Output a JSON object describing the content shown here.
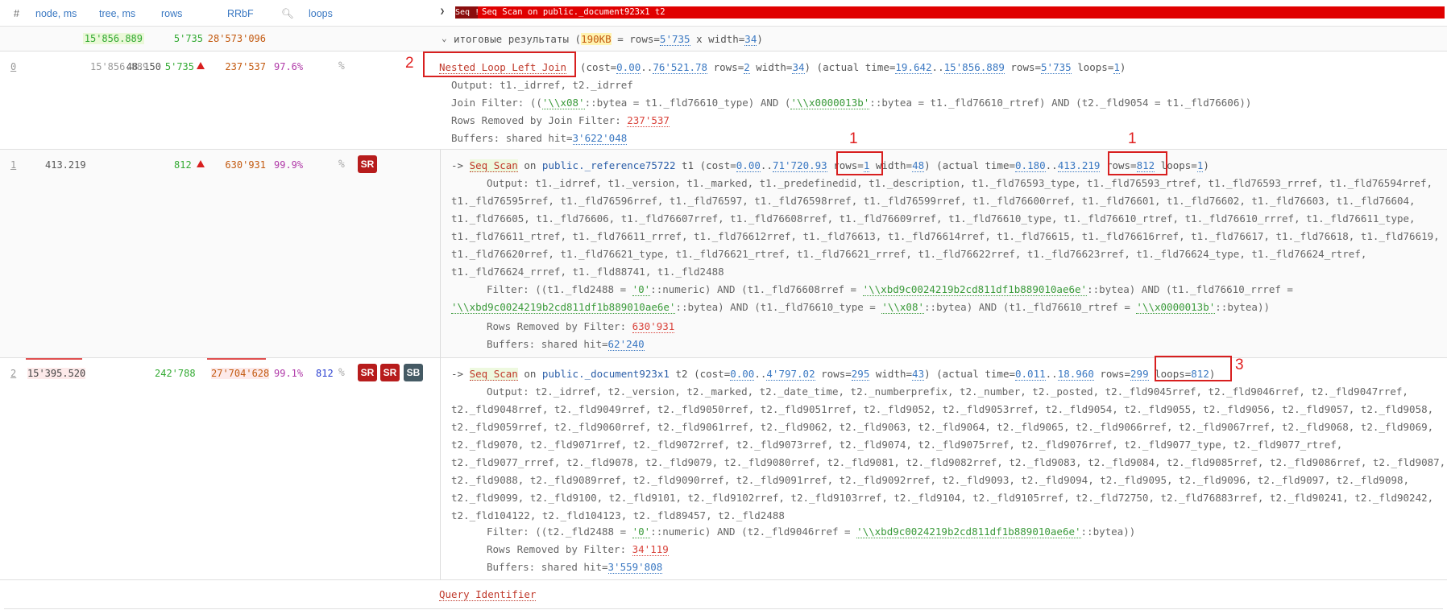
{
  "header": {
    "hash": "#",
    "node_ms": "node, ms",
    "tree_ms": "tree, ms",
    "rows": "rows",
    "rrbf": "RRbF",
    "loops": "loops",
    "tab_short": "Seq !",
    "tab_title": "Seq Scan on public._document923x1 t2"
  },
  "totals": {
    "tree_ms": "15'856.889",
    "rows": "5'735",
    "rrbf": "28'573'096",
    "label": "итоговые результаты",
    "size": "190KB",
    "expr_eq": " = rows=",
    "rows_val": "5'735",
    "x_width": " x width=",
    "width_val": "34",
    "close": ")"
  },
  "nodes": [
    {
      "idx": "0",
      "node_ms": "48.150",
      "tree_ms": "15'856.889",
      "rows": "5'735",
      "rrbf": "237'537",
      "pct": "97.6%",
      "title": "Nested Loop Left Join",
      "cost_a": "0.00",
      "cost_b": "76'521.78",
      "rows_est": "2",
      "width": "34",
      "time_a": "19.642",
      "time_b": "15'856.889",
      "rows_act": "5'735",
      "loops": "1",
      "output": "Output: t1._idrref, t2._idrref",
      "join_filter_pre": "Join Filter: ((",
      "jf_s1": "'\\\\x08'",
      "jf_m1": "::bytea = t1._fld76610_type) AND (",
      "jf_s2": "'\\\\x0000013b'",
      "jf_m2": "::bytea = t1._fld76610_rtref) AND (t2._fld9054 = t1._fld76606))",
      "removed_label": "Rows Removed by Join Filter: ",
      "removed": "237'537",
      "buffers_label": "Buffers: shared hit=",
      "buffers": "3'622'048"
    },
    {
      "idx": "1",
      "node_ms": "413.219",
      "rows": "812",
      "rrbf": "630'931",
      "pct": "99.9%",
      "badge": "SR",
      "scan": "Seq Scan",
      "on": " on ",
      "rel": "public._reference75722",
      "alias": " t1",
      "cost_a": "0.00",
      "cost_b": "71'720.93",
      "rows_est": "1",
      "width": "48",
      "time_a": "0.180",
      "time_b": "413.219",
      "rows_act": "812",
      "loops": "1",
      "output_lines": [
        "Output: t1._idrref, t1._version, t1._marked, t1._predefinedid, t1._description, t1._fld76593_type, t1._fld76593_rtref, t1._fld76593_rrref, t1._fld76594rref,",
        "t1._fld76595rref, t1._fld76596rref, t1._fld76597, t1._fld76598rref, t1._fld76599rref, t1._fld76600rref, t1._fld76601, t1._fld76602, t1._fld76603, t1._fld76604,",
        "t1._fld76605, t1._fld76606, t1._fld76607rref, t1._fld76608rref, t1._fld76609rref, t1._fld76610_type, t1._fld76610_rtref, t1._fld76610_rrref, t1._fld76611_type,",
        "t1._fld76611_rtref, t1._fld76611_rrref, t1._fld76612rref, t1._fld76613, t1._fld76614rref, t1._fld76615, t1._fld76616rref, t1._fld76617, t1._fld76618, t1._fld76619,",
        "t1._fld76620rref, t1._fld76621_type, t1._fld76621_rtref, t1._fld76621_rrref, t1._fld76622rref, t1._fld76623rref, t1._fld76624_type, t1._fld76624_rtref,",
        "t1._fld76624_rrref, t1._fld88741, t1._fld2488"
      ],
      "filter_pre": "Filter: ((t1._fld2488 = ",
      "f_s0": "'0'",
      "f_m0": "::numeric) AND (t1._fld76608rref = ",
      "f_s1": "'\\\\xbd9c0024219b2cd811df1b889010ae6e'",
      "f_m1": "::bytea) AND (t1._fld76610_rrref =",
      "f_s2": "'\\\\xbd9c0024219b2cd811df1b889010ae6e'",
      "f_m2": "::bytea) AND (t1._fld76610_type = ",
      "f_s3": "'\\\\x08'",
      "f_m3": "::bytea) AND (t1._fld76610_rtref = ",
      "f_s4": "'\\\\x0000013b'",
      "f_m4": "::bytea))",
      "removed_label": "Rows Removed by Filter: ",
      "removed": "630'931",
      "buffers_label": "Buffers: shared hit=",
      "buffers": "62'240"
    },
    {
      "idx": "2",
      "node_ms": "15'395.520",
      "rows": "242'788",
      "rrbf": "27'704'628",
      "pct": "99.1%",
      "loops_col": "812",
      "badges": [
        "SR",
        "SR",
        "SB"
      ],
      "scan": "Seq Scan",
      "on": " on ",
      "rel": "public._document923x1",
      "alias": " t2",
      "cost_a": "0.00",
      "cost_b": "4'797.02",
      "rows_est": "295",
      "width": "43",
      "time_a": "0.011",
      "time_b": "18.960",
      "rows_act": "299",
      "loops": "812",
      "output_lines": [
        "Output: t2._idrref, t2._version, t2._marked, t2._date_time, t2._numberprefix, t2._number, t2._posted, t2._fld9045rref, t2._fld9046rref, t2._fld9047rref,",
        "t2._fld9048rref, t2._fld9049rref, t2._fld9050rref, t2._fld9051rref, t2._fld9052, t2._fld9053rref, t2._fld9054, t2._fld9055, t2._fld9056, t2._fld9057, t2._fld9058,",
        "t2._fld9059rref, t2._fld9060rref, t2._fld9061rref, t2._fld9062, t2._fld9063, t2._fld9064, t2._fld9065, t2._fld9066rref, t2._fld9067rref, t2._fld9068, t2._fld9069,",
        "t2._fld9070, t2._fld9071rref, t2._fld9072rref, t2._fld9073rref, t2._fld9074, t2._fld9075rref, t2._fld9076rref, t2._fld9077_type, t2._fld9077_rtref,",
        "t2._fld9077_rrref, t2._fld9078, t2._fld9079, t2._fld9080rref, t2._fld9081, t2._fld9082rref, t2._fld9083, t2._fld9084, t2._fld9085rref, t2._fld9086rref, t2._fld9087,",
        "t2._fld9088, t2._fld9089rref, t2._fld9090rref, t2._fld9091rref, t2._fld9092rref, t2._fld9093, t2._fld9094, t2._fld9095, t2._fld9096, t2._fld9097, t2._fld9098,",
        "t2._fld9099, t2._fld9100, t2._fld9101, t2._fld9102rref, t2._fld9103rref, t2._fld9104, t2._fld9105rref, t2._fld72750, t2._fld76883rref, t2._fld90241, t2._fld90242,",
        "t2._fld104122, t2._fld104123, t2._fld89457, t2._fld2488"
      ],
      "filter_pre": "Filter: ((t2._fld2488 = ",
      "f_s0": "'0'",
      "f_m0": "::numeric) AND (t2._fld9046rref = ",
      "f_s1": "'\\\\xbd9c0024219b2cd811df1b889010ae6e'",
      "f_m1": "::bytea))",
      "removed_label": "Rows Removed by Filter: ",
      "removed": "34'119",
      "buffers_label": "Buffers: shared hit=",
      "buffers": "3'559'808"
    }
  ],
  "footer": {
    "query_id": "Query Identifier"
  },
  "syntax": {
    "arrow": "->",
    "cost_open": "(cost=",
    "range": "..",
    "rows_eq": " rows=",
    "width_eq": " width=",
    "actual_open": ") (actual time=",
    "loops_eq": " loops=",
    "close": ")",
    "rows_kw": "rows=",
    "loops_kw": "loops="
  },
  "annotations": {
    "one": "1",
    "two": "2",
    "three": "3"
  },
  "colors": {
    "accent": "#3a78c2",
    "tab_red": "#e00000",
    "badge_sr": "#b71c1c",
    "badge_sb": "#455a64",
    "annot": "#d81f1f"
  }
}
